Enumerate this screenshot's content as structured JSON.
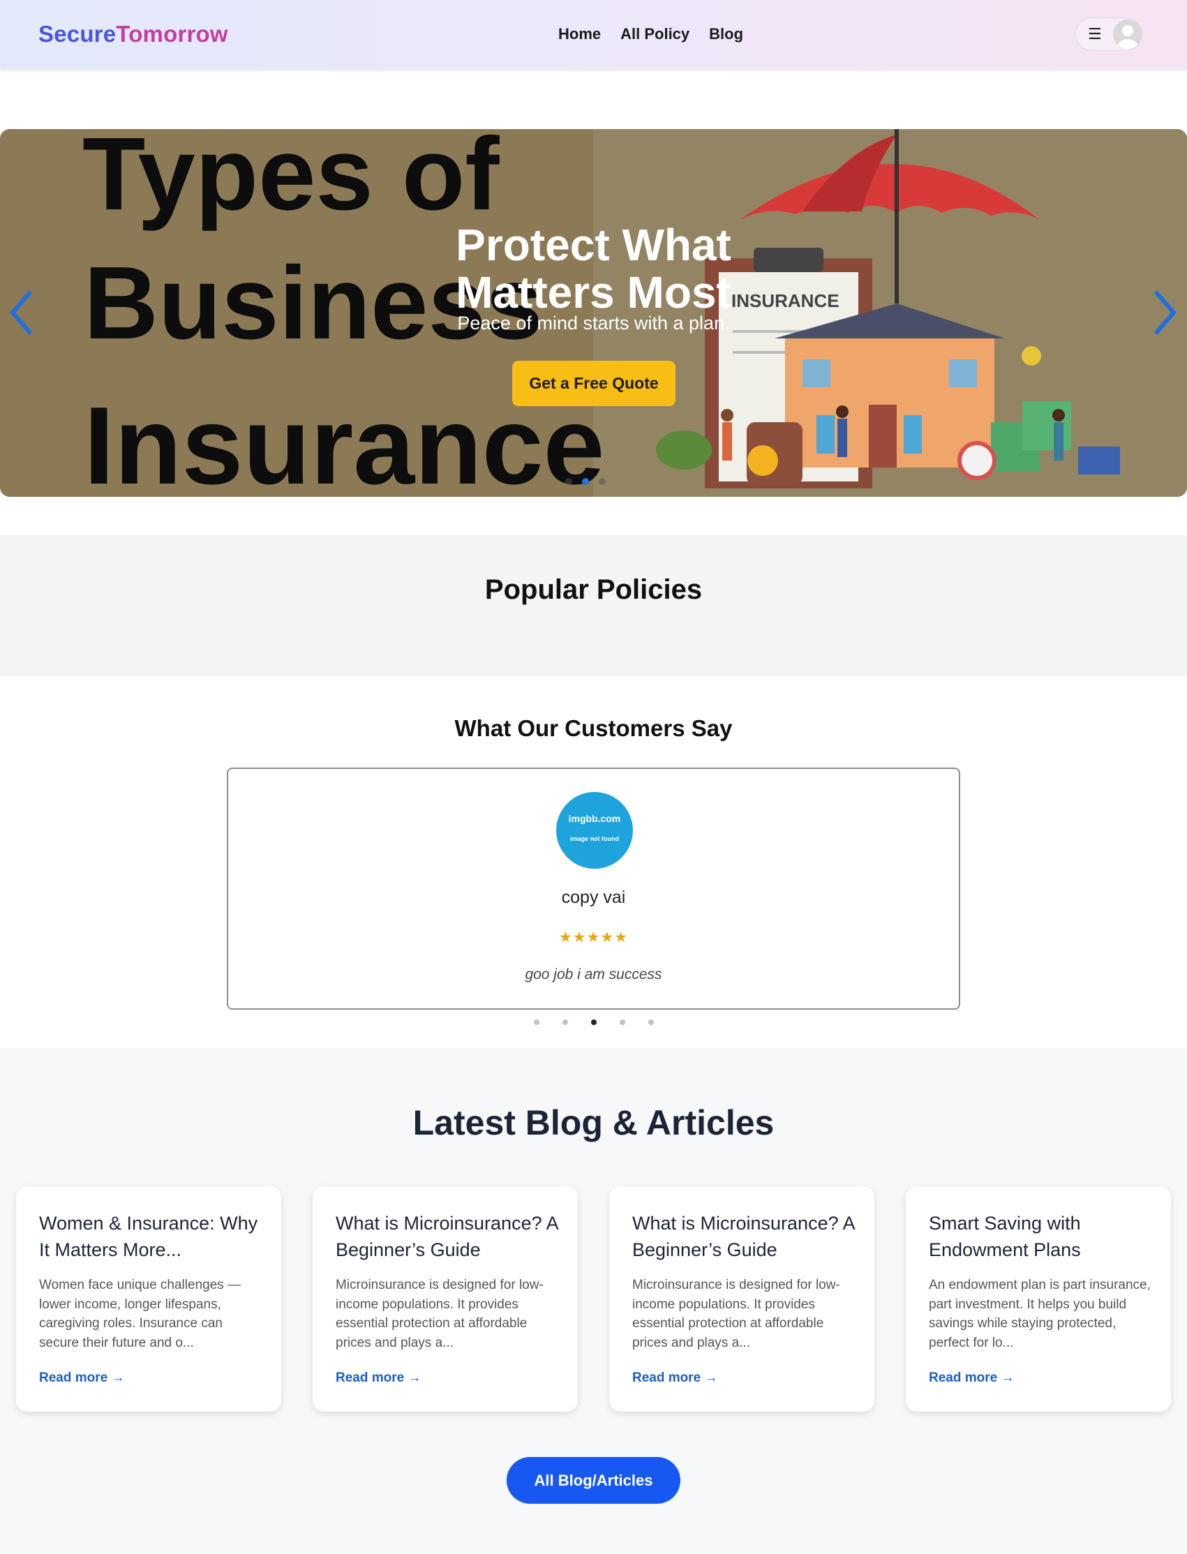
{
  "brand": {
    "part1": "Secure",
    "part2": "Tomorrow"
  },
  "nav": {
    "links": [
      "Home",
      "All Policy",
      "Blog"
    ],
    "menu_icon": "hamburger-icon",
    "avatar_icon": "user-avatar-icon"
  },
  "hero": {
    "bg_text": [
      "Types of",
      "Business",
      "Insurance"
    ],
    "bg_sign": "INSURANCE",
    "title_line1": "Protect What",
    "title_line2": "Matters Most",
    "subtitle": "Peace of mind starts with a plan.",
    "cta": "Get a Free Quote",
    "slide_count": 3,
    "active_slide": 2
  },
  "policies": {
    "title": "Popular Policies"
  },
  "testimonials": {
    "title": "What Our Customers Say",
    "avatar_line1": "imgbb.com",
    "avatar_line2": "image not found",
    "name": "copy vai",
    "stars": "★★★★★",
    "rating": 5,
    "quote": "goo job i am success",
    "dot_count": 5,
    "active_dot": 3
  },
  "blog": {
    "title": "Latest Blog & Articles",
    "cards": [
      {
        "title": "Women & Insurance: Why It Matters More...",
        "excerpt": "Women face unique challenges — lower income, longer lifespans, caregiving roles. Insurance can secure their future and o...",
        "link": "Read more →"
      },
      {
        "title": "What is Microinsurance? A Beginner’s Guide",
        "excerpt": "Microinsurance is designed for low-income populations. It provides essential protection at affordable prices and plays a...",
        "link": "Read more →"
      },
      {
        "title": "What is Microinsurance? A Beginner’s Guide",
        "excerpt": "Microinsurance is designed for low-income populations. It provides essential protection at affordable prices and plays a...",
        "link": "Read more →"
      },
      {
        "title": "Smart Saving with Endowment Plans",
        "excerpt": "An endowment plan is part insurance, part investment. It helps you build savings while staying protected, perfect for lo...",
        "link": "Read more →"
      }
    ],
    "button": "All Blog/Articles"
  },
  "colors": {
    "brand_blue": "#4a55e0",
    "brand_pink": "#c43fa3",
    "cta_yellow": "#f7bf15",
    "link_blue": "#1f5dc2",
    "button_blue": "#1758f2",
    "star": "#e8a716"
  }
}
